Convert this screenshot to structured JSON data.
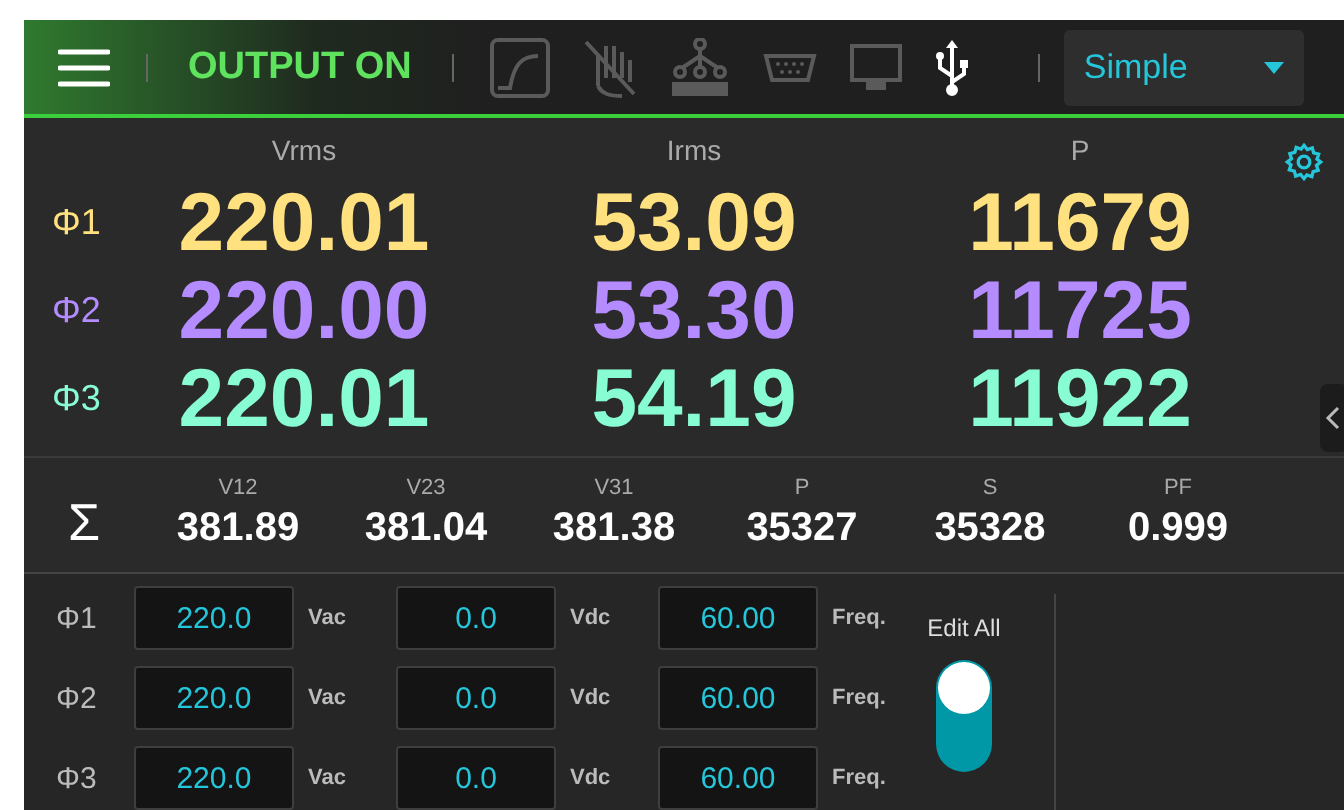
{
  "header": {
    "output_status": "OUTPUT ON",
    "output_on": true,
    "mode_dropdown": {
      "value": "Simple"
    }
  },
  "readings": {
    "columns": [
      "Vrms",
      "Irms",
      "P"
    ],
    "rows": [
      {
        "phase": "Φ1",
        "color": "#ffe27f",
        "values": [
          "220.01",
          "53.09",
          "11679"
        ]
      },
      {
        "phase": "Φ2",
        "color": "#b58cff",
        "values": [
          "220.00",
          "53.30",
          "11725"
        ]
      },
      {
        "phase": "Φ3",
        "color": "#88fcd2",
        "values": [
          "220.01",
          "54.19",
          "11922"
        ]
      }
    ]
  },
  "totals": {
    "symbol": "Σ",
    "items": [
      {
        "label": "V12",
        "value": "381.89"
      },
      {
        "label": "V23",
        "value": "381.04"
      },
      {
        "label": "V31",
        "value": "381.38"
      },
      {
        "label": "P",
        "value": "35327"
      },
      {
        "label": "S",
        "value": "35328"
      },
      {
        "label": "PF",
        "value": "0.999"
      }
    ]
  },
  "settings": {
    "rows": [
      {
        "phase": "Φ1",
        "fields": [
          {
            "value": "220.0",
            "unit": "Vac"
          },
          {
            "value": "0.0",
            "unit": "Vdc"
          },
          {
            "value": "60.00",
            "unit": "Freq."
          }
        ]
      },
      {
        "phase": "Φ2",
        "fields": [
          {
            "value": "220.0",
            "unit": "Vac"
          },
          {
            "value": "0.0",
            "unit": "Vdc"
          },
          {
            "value": "60.00",
            "unit": "Freq."
          }
        ]
      },
      {
        "phase": "Φ3",
        "fields": [
          {
            "value": "220.0",
            "unit": "Vac"
          },
          {
            "value": "0.0",
            "unit": "Vdc"
          },
          {
            "value": "60.00",
            "unit": "Freq."
          }
        ]
      }
    ],
    "edit_all": {
      "label": "Edit All",
      "on": true
    }
  }
}
